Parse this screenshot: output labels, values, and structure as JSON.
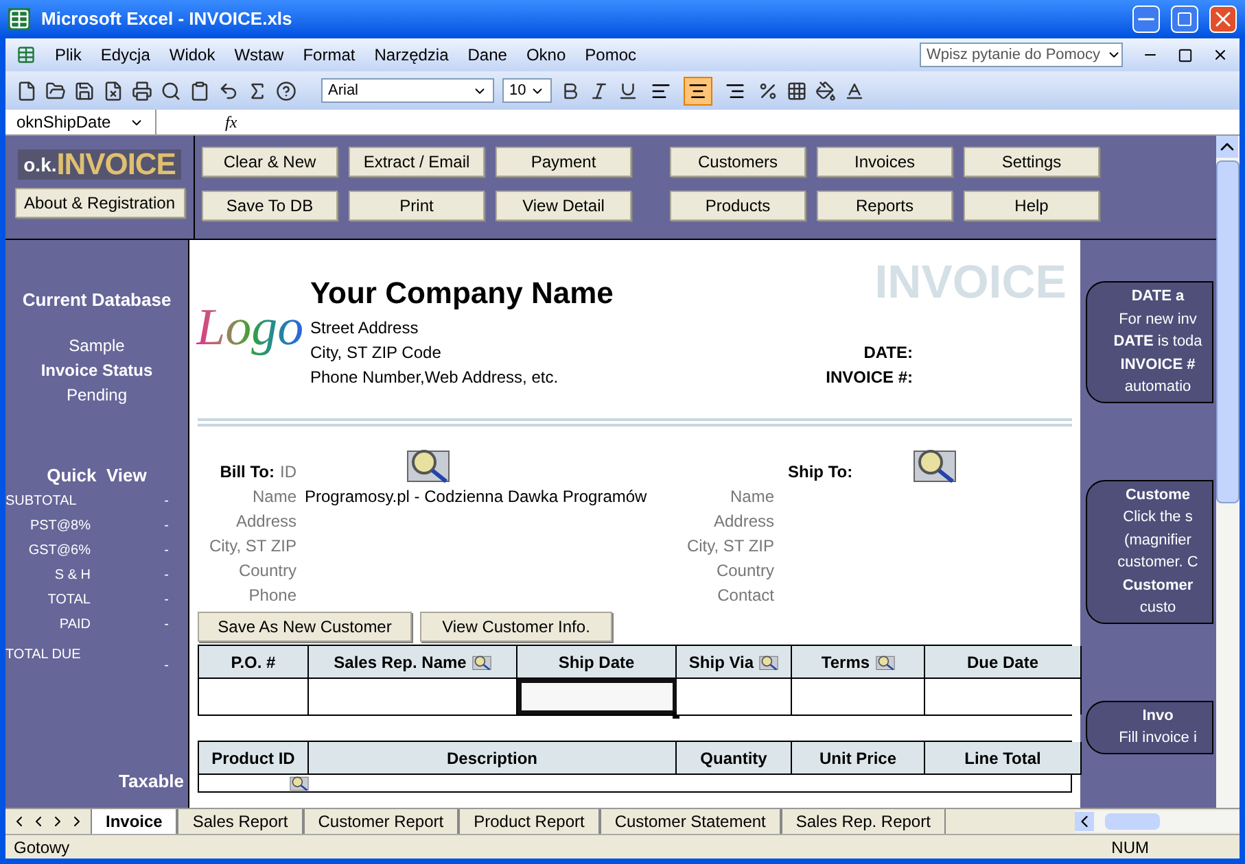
{
  "window": {
    "title": "Microsoft Excel - INVOICE.xls"
  },
  "menu": [
    "Plik",
    "Edycja",
    "Widok",
    "Wstaw",
    "Format",
    "Narzędzia",
    "Dane",
    "Okno",
    "Pomoc"
  ],
  "help_box": {
    "placeholder": "Wpisz pytanie do Pomocy"
  },
  "toolbar": {
    "font": "Arial",
    "size": "10",
    "align_buttons": [
      {
        "selected": false
      },
      {
        "selected": true
      },
      {
        "selected": false
      }
    ]
  },
  "formula_bar": {
    "name_box": "oknShipDate",
    "fx": "fx"
  },
  "logo": {
    "prefix": "o.k.",
    "word": "INVOICE"
  },
  "about_button": "About & Registration",
  "buttons": [
    [
      "Clear & New",
      "Extract / Email",
      "Payment",
      "Customers",
      "Invoices",
      "Settings"
    ],
    [
      "Save To DB",
      "Print",
      "View Detail",
      "Products",
      "Reports",
      "Help"
    ]
  ],
  "sidebar": {
    "database_heading": "Current Database",
    "database": "Sample",
    "status_heading": "Invoice Status",
    "status": "Pending",
    "quick_view_heading": "Quick  View",
    "quick_view": [
      {
        "label": "SUBTOTAL",
        "value": "-"
      },
      {
        "label": "PST@8%",
        "value": "-"
      },
      {
        "label": "GST@6%",
        "value": "-"
      },
      {
        "label": "S & H",
        "value": "-"
      },
      {
        "label": "TOTAL",
        "value": "-"
      },
      {
        "label": "PAID",
        "value": "-"
      }
    ],
    "total_due": {
      "label": "TOTAL DUE",
      "value": "-"
    },
    "taxable": "Taxable"
  },
  "invoice": {
    "logo_text": "Logo",
    "company": "Your Company Name",
    "address_lines": [
      "Street Address",
      "City, ST  ZIP Code",
      "Phone Number,Web Address, etc."
    ],
    "title": "INVOICE",
    "date_label": "DATE:",
    "number_label": "INVOICE #:"
  },
  "bill_to": {
    "heading": "Bill To:",
    "fields": [
      {
        "label": "ID"
      },
      {
        "label": "Name",
        "value": "Programosy.pl - Codzienna Dawka Programów"
      },
      {
        "label": "Address"
      },
      {
        "label": "City, ST ZIP"
      },
      {
        "label": "Country"
      },
      {
        "label": "Phone"
      }
    ]
  },
  "ship_to": {
    "heading": "Ship To:",
    "fields": [
      "Name",
      "Address",
      "City, ST ZIP",
      "Country",
      "Contact"
    ]
  },
  "customer_buttons": [
    "Save As New Customer",
    "View Customer Info."
  ],
  "order_table": {
    "columns": [
      {
        "label": "P.O. #",
        "lookup": false
      },
      {
        "label": "Sales Rep. Name",
        "lookup": true
      },
      {
        "label": "Ship Date",
        "lookup": false
      },
      {
        "label": "Ship Via",
        "lookup": true
      },
      {
        "label": "Terms",
        "lookup": true
      },
      {
        "label": "Due Date",
        "lookup": false
      }
    ],
    "row": [
      {
        "selected": false
      },
      {
        "selected": false
      },
      {
        "selected": true
      },
      {
        "selected": false
      },
      {
        "selected": false
      },
      {
        "selected": false
      }
    ]
  },
  "items_table": {
    "columns": [
      "Product ID",
      "Description",
      "Quantity",
      "Unit Price",
      "Line Total"
    ]
  },
  "notes": [
    {
      "lines": [
        "**DATE a**",
        "For new inv",
        "**DATE** is toda",
        "**INVOICE #**",
        "automatio"
      ]
    },
    {
      "lines": [
        "**Custome**",
        "Click the s",
        "(magnifier",
        "customer. C",
        "**Customer**",
        "custo"
      ]
    },
    {
      "lines": [
        "**Invo**",
        "Fill invoice i"
      ]
    }
  ],
  "sheet_tabs": [
    {
      "label": "Invoice",
      "selected": true
    },
    {
      "label": "Sales Report",
      "selected": false
    },
    {
      "label": "Customer Report",
      "selected": false
    },
    {
      "label": "Product Report",
      "selected": false
    },
    {
      "label": "Customer Statement",
      "selected": false
    },
    {
      "label": "Sales Rep. Report",
      "selected": false
    }
  ],
  "status_bar": {
    "status": "Gotowy",
    "indicator": "NUM"
  }
}
